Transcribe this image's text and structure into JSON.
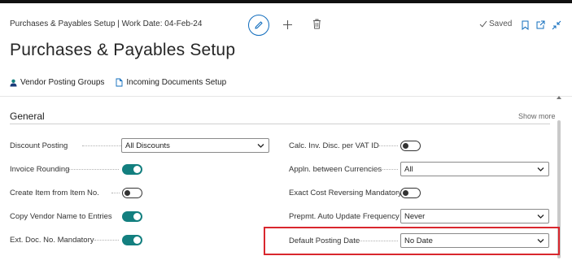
{
  "header": {
    "breadcrumb": "Purchases & Payables Setup | Work Date: 04-Feb-24",
    "saved_label": "Saved"
  },
  "page_title": "Purchases & Payables Setup",
  "actions": [
    {
      "label": "Vendor Posting Groups",
      "icon": "person-icon"
    },
    {
      "label": "Incoming Documents Setup",
      "icon": "document-icon"
    }
  ],
  "section": {
    "title": "General",
    "show_more": "Show more"
  },
  "left_fields": [
    {
      "label": "Discount Posting",
      "type": "select",
      "value": "All Discounts"
    },
    {
      "label": "Invoice Rounding",
      "type": "toggle",
      "value": true
    },
    {
      "label": "Create Item from Item No.",
      "type": "toggle",
      "value": false
    },
    {
      "label": "Copy Vendor Name to Entries",
      "type": "toggle",
      "value": true
    },
    {
      "label": "Ext. Doc. No. Mandatory",
      "type": "toggle",
      "value": true
    }
  ],
  "right_fields": [
    {
      "label": "Calc. Inv. Disc. per VAT ID",
      "type": "toggle",
      "value": false
    },
    {
      "label": "Appln. between Currencies",
      "type": "select",
      "value": "All"
    },
    {
      "label": "Exact Cost Reversing Mandatory",
      "type": "toggle",
      "value": false
    },
    {
      "label": "Prepmt. Auto Update Frequency",
      "type": "select",
      "value": "Never"
    },
    {
      "label": "Default Posting Date",
      "type": "select",
      "value": "No Date"
    }
  ],
  "colors": {
    "accent": "#137f7f",
    "brand_blue": "#0f6cbd",
    "highlight": "#d9272e"
  }
}
